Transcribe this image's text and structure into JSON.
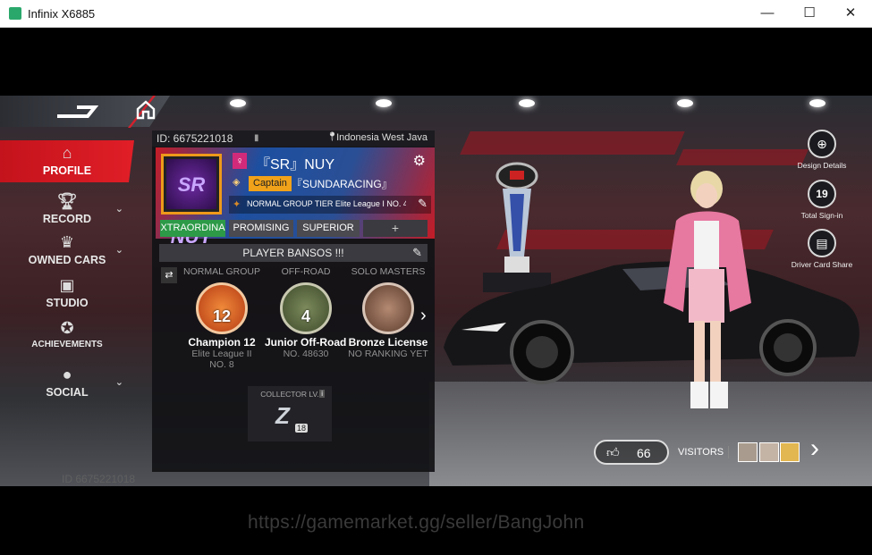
{
  "window": {
    "title": "Infinix X6885",
    "minimize": "—",
    "maximize": "☐",
    "close": "✕"
  },
  "sidebar": {
    "items": [
      {
        "label": "PROFILE",
        "icon": "home-icon"
      },
      {
        "label": "RECORD",
        "icon": "trophy-icon"
      },
      {
        "label": "OWNED CARS",
        "icon": "crown-icon"
      },
      {
        "label": "STUDIO",
        "icon": "car-icon"
      },
      {
        "label": "ACHIEVEMENTS",
        "icon": "medal-icon"
      },
      {
        "label": "SOCIAL",
        "icon": "person-icon"
      }
    ]
  },
  "profile": {
    "id": "ID: 6675221018",
    "location": "Indonesia West Java",
    "name": "『SR』NUY",
    "role": "Captain",
    "club": "『SUNDARACING』",
    "tier": "NORMAL GROUP TIER Elite League I NO. 4",
    "tags": [
      "XTRAORDINA",
      "PROMISING",
      "SUPERIOR"
    ],
    "add_tag": "+",
    "banner": "PLAYER BANSOS !!!",
    "avatar_text": "SR NUY"
  },
  "ranks": [
    {
      "header": "NORMAL GROUP",
      "badge": "12",
      "name": "Champion 12",
      "sub1": "Elite League II",
      "sub2": "NO. 8"
    },
    {
      "header": "OFF-ROAD",
      "badge": "4",
      "name": "Junior Off-Road 4",
      "sub1": "NO. 48630",
      "sub2": ""
    },
    {
      "header": "SOLO MASTERS",
      "badge": "",
      "name": "Bronze License",
      "sub1": "NO RANKING YET",
      "sub2": ""
    }
  ],
  "collector": {
    "label": "COLLECTOR LV.",
    "level": "18"
  },
  "right_actions": [
    {
      "label": "Design Details",
      "icon": "magnifier-icon"
    },
    {
      "label": "Total Sign-in",
      "icon": "calendar-icon",
      "value": "19"
    },
    {
      "label": "Driver Card Share",
      "icon": "id-card-icon"
    }
  ],
  "likes": {
    "count": "66"
  },
  "visitors": {
    "label": "VISITORS"
  },
  "bottom_id": "ID 6675221018",
  "watermark": "https://gamemarket.gg/seller/BangJohn",
  "colors": {
    "accent": "#d5202c",
    "gold": "#ee9a1a",
    "panel": "#121216"
  }
}
